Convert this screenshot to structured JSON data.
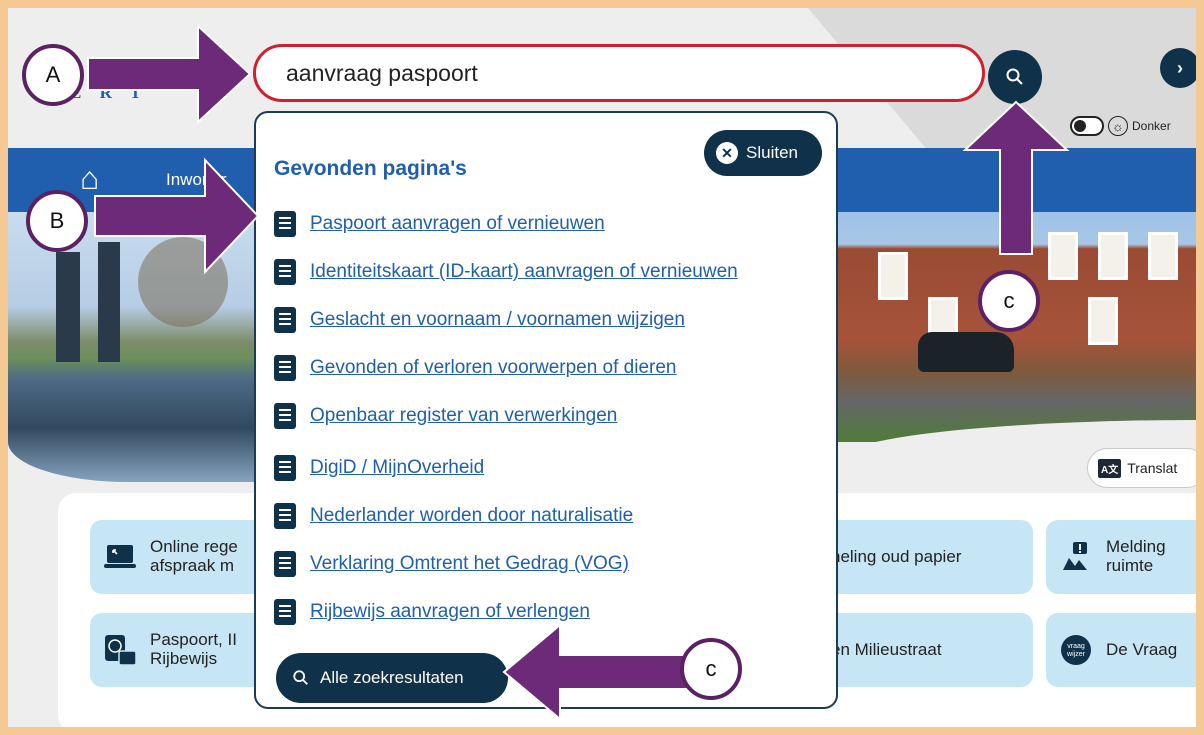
{
  "search": {
    "value": "aanvraag paspoort"
  },
  "logo": {
    "text": "E R T"
  },
  "next_icon": "›",
  "header": {
    "dark_mode_label": "Donker"
  },
  "nav": {
    "home_icon": "home-icon",
    "items": [
      "Inwoner"
    ],
    "more": "›"
  },
  "translate": {
    "badge": "A文",
    "label": "Translat"
  },
  "popup": {
    "title": "Gevonden pagina's",
    "close_label": "Sluiten",
    "results": [
      "Paspoort aanvragen of vernieuwen",
      "Identiteitskaart (ID-kaart) aanvragen of vernieuwen",
      "Geslacht en voornaam / voornamen wijzigen",
      "Gevonden of verloren voorwerpen of dieren",
      "Openbaar register van verwerkingen",
      "DigiD / MijnOverheid",
      "Nederlander worden door naturalisatie",
      "Verklaring Omtrent het Gedrag (VOG)",
      "Rijbewijs aanvragen of verlengen"
    ],
    "all_results_label": "Alle zoekresultaten"
  },
  "tiles": {
    "online": {
      "line1": "Online rege",
      "line2": "afspraak m"
    },
    "paspoort": {
      "line1": "Paspoort, II",
      "line2": "Rijbewijs"
    },
    "papier": {
      "line1": "neling oud papier"
    },
    "milieustraat": {
      "line1": "en Milieustraat"
    },
    "melding": {
      "line1": "Melding",
      "line2": "ruimte"
    },
    "vraag": {
      "line1": "De Vraag",
      "badge": "vraag wijzer"
    }
  },
  "markers": {
    "a": "A",
    "b": "B",
    "c_top": "c",
    "c_bottom": "c"
  },
  "colors": {
    "accent": "#1f5fae",
    "dark": "#10314a",
    "annotation": "#6d2a78",
    "search_border": "#d0202f",
    "tile": "#c7e6f5",
    "frame": "#f5c993"
  }
}
